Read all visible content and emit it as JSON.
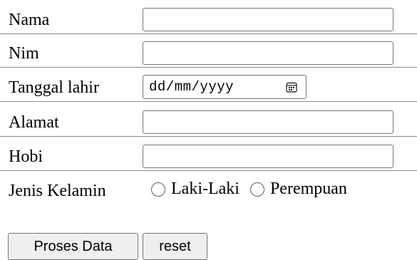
{
  "form": {
    "rows": [
      {
        "label": "Nama",
        "value": "",
        "placeholder": ""
      },
      {
        "label": "Nim",
        "value": "",
        "placeholder": ""
      },
      {
        "label": "Tanggal lahir",
        "value": "dd/mm/yyyy"
      },
      {
        "label": "Alamat",
        "value": "",
        "placeholder": ""
      },
      {
        "label": "Hobi",
        "value": "",
        "placeholder": ""
      },
      {
        "label": "Jenis Kelamin"
      }
    ],
    "gender_options": [
      {
        "label": "Laki-Laki",
        "checked": false
      },
      {
        "label": "Perempuan",
        "checked": false
      }
    ],
    "buttons": {
      "proses": "Proses Data",
      "reset": "reset"
    }
  },
  "icons": {
    "calendar": "calendar-icon"
  },
  "colors": {
    "border": "#767676",
    "divider": "#8a8a8a",
    "button_bg": "#efefef",
    "text": "#000000",
    "background": "#ffffff"
  }
}
